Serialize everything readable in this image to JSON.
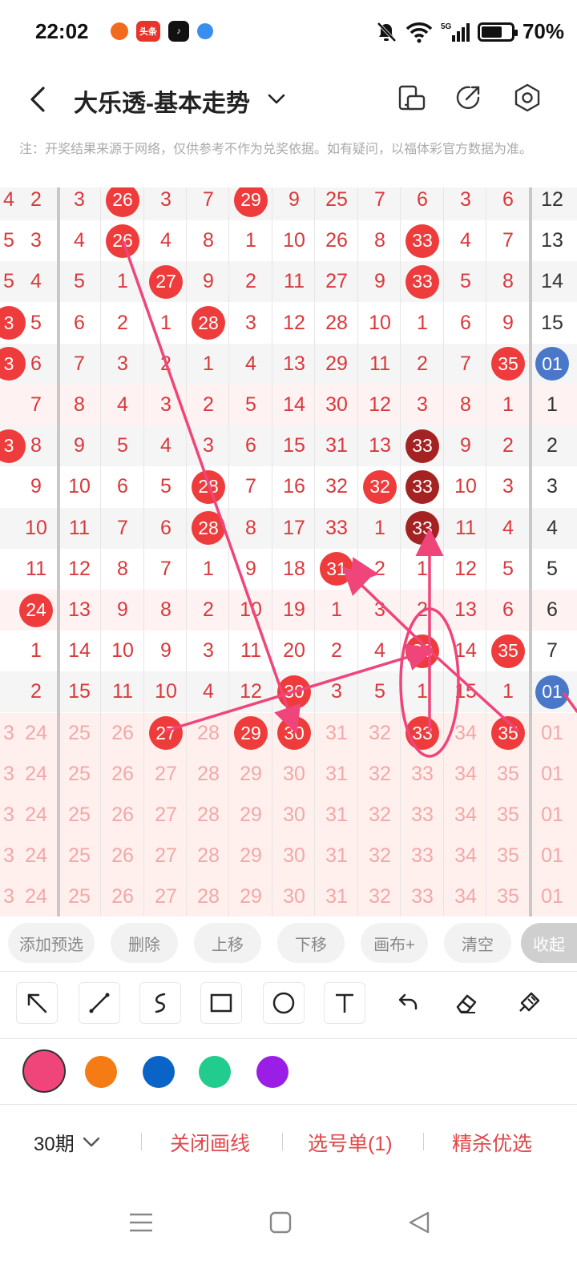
{
  "status": {
    "time": "22:02",
    "battery": "70%",
    "battery_level": 0.7,
    "network": "5G"
  },
  "header": {
    "title": "大乐透-基本走势"
  },
  "notice": "注：开奖结果来源于网络，仅供参考不作为兑奖依据。如有疑问，以福体彩官方数据为准。",
  "grid": {
    "rows": [
      [
        "4",
        "2",
        "3",
        "26",
        "3",
        "7",
        "29",
        "9",
        "25",
        "7",
        "6",
        "3",
        "6",
        "12"
      ],
      [
        "5",
        "3",
        "4",
        "26",
        "4",
        "8",
        "1",
        "10",
        "26",
        "8",
        "33",
        "4",
        "7",
        "13"
      ],
      [
        "5",
        "4",
        "5",
        "1",
        "27",
        "9",
        "2",
        "11",
        "27",
        "9",
        "33",
        "5",
        "8",
        "14"
      ],
      [
        "3",
        "5",
        "6",
        "2",
        "1",
        "28",
        "3",
        "12",
        "28",
        "10",
        "1",
        "6",
        "9",
        "15"
      ],
      [
        "3",
        "6",
        "7",
        "3",
        "2",
        "1",
        "4",
        "13",
        "29",
        "11",
        "2",
        "7",
        "35",
        "01"
      ],
      [
        "",
        "7",
        "8",
        "4",
        "3",
        "2",
        "5",
        "14",
        "30",
        "12",
        "3",
        "8",
        "1",
        "1"
      ],
      [
        "3",
        "8",
        "9",
        "5",
        "4",
        "3",
        "6",
        "15",
        "31",
        "13",
        "33",
        "9",
        "2",
        "2"
      ],
      [
        "",
        "9",
        "10",
        "6",
        "5",
        "28",
        "7",
        "16",
        "32",
        "32",
        "33",
        "10",
        "3",
        "3"
      ],
      [
        "",
        "10",
        "11",
        "7",
        "6",
        "28",
        "8",
        "17",
        "33",
        "1",
        "33",
        "11",
        "4",
        "4"
      ],
      [
        "",
        "11",
        "12",
        "8",
        "7",
        "1",
        "9",
        "18",
        "31",
        "2",
        "1",
        "12",
        "5",
        "5"
      ],
      [
        "",
        "24",
        "13",
        "9",
        "8",
        "2",
        "10",
        "19",
        "1",
        "3",
        "2",
        "13",
        "6",
        "6"
      ],
      [
        "",
        "1",
        "14",
        "10",
        "9",
        "3",
        "11",
        "20",
        "2",
        "4",
        "33",
        "14",
        "35",
        "7"
      ],
      [
        "",
        "2",
        "15",
        "11",
        "10",
        "4",
        "12",
        "30",
        "3",
        "5",
        "1",
        "15",
        "1",
        "01"
      ],
      [
        "3",
        "24",
        "25",
        "26",
        "27",
        "28",
        "29",
        "30",
        "31",
        "32",
        "33",
        "34",
        "35",
        "01"
      ],
      [
        "3",
        "24",
        "25",
        "26",
        "27",
        "28",
        "29",
        "30",
        "31",
        "32",
        "33",
        "34",
        "35",
        "01"
      ],
      [
        "3",
        "24",
        "25",
        "26",
        "27",
        "28",
        "29",
        "30",
        "31",
        "32",
        "33",
        "34",
        "35",
        "01"
      ],
      [
        "3",
        "24",
        "25",
        "26",
        "27",
        "28",
        "29",
        "30",
        "31",
        "32",
        "33",
        "34",
        "35",
        "01"
      ],
      [
        "3",
        "24",
        "25",
        "26",
        "27",
        "28",
        "29",
        "30",
        "31",
        "32",
        "33",
        "34",
        "35",
        "01"
      ]
    ]
  },
  "chips": {
    "add_preselect": "添加预选",
    "delete": "删除",
    "move_up": "上移",
    "move_down": "下移",
    "canvas_plus": "画布+",
    "clear": "清空",
    "collapse": "收起"
  },
  "colors": {
    "pink": "#f0457a",
    "orange": "#f57c14",
    "blue": "#0a64c8",
    "green": "#22cc8e",
    "purple": "#9a1ee6",
    "accent_red": "#e0474a",
    "ball_red": "#ee3b3b",
    "ball_dark": "#a52222",
    "ball_blue": "#4a78c8"
  },
  "bottom": {
    "period": "30期",
    "close_draw": "关闭画线",
    "pick_list": "选号单(1)",
    "refined": "精杀优选"
  }
}
